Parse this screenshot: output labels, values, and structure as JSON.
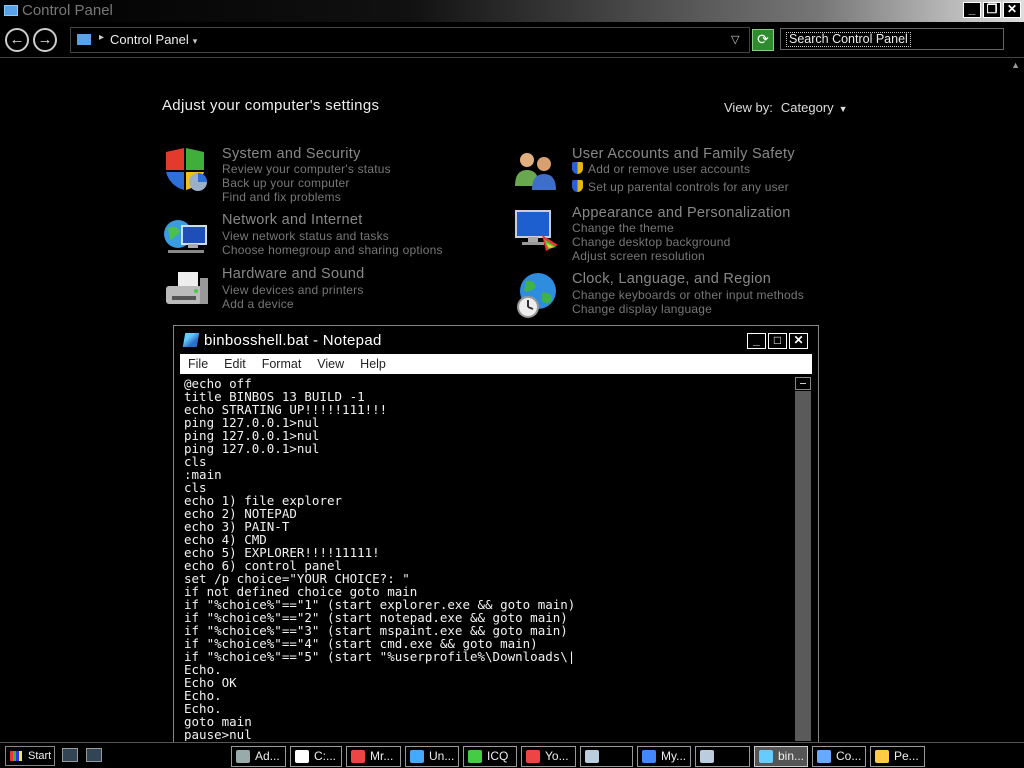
{
  "window": {
    "title": "Control Panel"
  },
  "address": {
    "location": "Control Panel",
    "search_placeholder": "Search Control Panel"
  },
  "main": {
    "heading": "Adjust your computer's settings",
    "view_by_label": "View by:",
    "view_by_value": "Category"
  },
  "categories": [
    {
      "title": "System and Security",
      "links": [
        "Review your computer's status",
        "Back up your computer",
        "Find and fix problems"
      ]
    },
    {
      "title": "Network and Internet",
      "links": [
        "View network status and tasks",
        "Choose homegroup and sharing options"
      ]
    },
    {
      "title": "Hardware and Sound",
      "links": [
        "View devices and printers",
        "Add a device"
      ]
    },
    {
      "title": "User Accounts and Family Safety",
      "links": [
        "Add or remove user accounts",
        "Set up parental controls for any user"
      ]
    },
    {
      "title": "Appearance and Personalization",
      "links": [
        "Change the theme",
        "Change desktop background",
        "Adjust screen resolution"
      ]
    },
    {
      "title": "Clock, Language, and Region",
      "links": [
        "Change keyboards or other input methods",
        "Change display language"
      ]
    }
  ],
  "notepad": {
    "title": "binbosshell.bat - Notepad",
    "menu": [
      "File",
      "Edit",
      "Format",
      "View",
      "Help"
    ],
    "lines": [
      "@echo off",
      "title BINBOS 13 BUILD -1",
      "echo STRATING UP!!!!!111!!!",
      "ping 127.0.0.1>nul",
      "ping 127.0.0.1>nul",
      "ping 127.0.0.1>nul",
      "cls",
      ":main",
      "cls",
      "echo 1) file explorer",
      "echo 2) NOTEPAD",
      "echo 3) PAIN-T",
      "echo 4) CMD",
      "echo 5) EXPLORER!!!!11111!",
      "echo 6) control panel",
      "set /p choice=\"YOUR CHOICE?: \"",
      "if not defined choice goto main",
      "if \"%choice%\"==\"1\" (start explorer.exe && goto main)",
      "if \"%choice%\"==\"2\" (start notepad.exe && goto main)",
      "if \"%choice%\"==\"3\" (start mspaint.exe && goto main)",
      "if \"%choice%\"==\"4\" (start cmd.exe && goto main)",
      "if \"%choice%\"==\"5\" (start \"%userprofile%\\Downloads\\|",
      "Echo.",
      "Echo OK",
      "Echo.",
      "Echo.",
      "goto main",
      "pause>nul"
    ]
  },
  "taskbar": {
    "start_label": "Start",
    "items": [
      {
        "label": "Ad...",
        "icon_color": "#9aa"
      },
      {
        "label": "C:...",
        "icon_color": "#fff"
      },
      {
        "label": "Mr...",
        "icon_color": "#e44"
      },
      {
        "label": "Un...",
        "icon_color": "#4af"
      },
      {
        "label": "ICQ",
        "icon_color": "#4c4"
      },
      {
        "label": "Yo...",
        "icon_color": "#e44"
      },
      {
        "label": "",
        "icon_color": "#bcd"
      },
      {
        "label": "My...",
        "icon_color": "#48f"
      },
      {
        "label": "",
        "icon_color": "#bcd"
      },
      {
        "label": "bin...",
        "icon_color": "#6cf",
        "active": true
      },
      {
        "label": "Co...",
        "icon_color": "#6af"
      },
      {
        "label": "Pe...",
        "icon_color": "#fc4"
      }
    ]
  }
}
